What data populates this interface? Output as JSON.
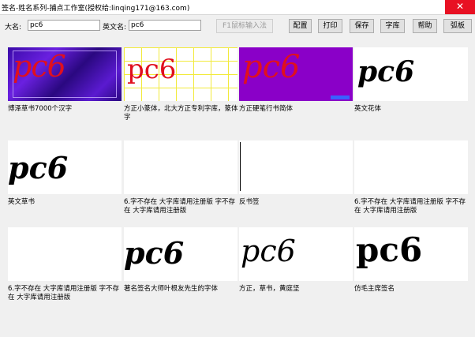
{
  "window": {
    "title": "签名-姓名系列-捕点工作室(授权给:linqing171@163.com)",
    "close_glyph": "✕"
  },
  "toolbar": {
    "chinese_name_label": "大名:",
    "chinese_name_value": "pc6",
    "english_name_label": "英文名:",
    "english_name_value": "pc6",
    "handwrite_input_label": "F1鼠标输入法",
    "config_label": "配置",
    "print_label": "打印",
    "save_label": "保存",
    "font_library_label": "字库",
    "help_label": "帮助",
    "template_label": "弧板"
  },
  "styles": [
    {
      "sample": "pc6",
      "caption": "博泽草书7000个汉字"
    },
    {
      "sample": "pc6",
      "caption": "方正小篆体，北大方正专利字库，篆体字"
    },
    {
      "sample": "pc6",
      "caption": "方正硬笔行书简体"
    },
    {
      "sample": "pc6",
      "caption": "英文花体"
    },
    {
      "sample": "pc6",
      "caption": "英文草书"
    },
    {
      "sample": "",
      "caption": "6.字不存在 大字库请用注册版 字不存在 大字库请用注册版"
    },
    {
      "sample": "",
      "caption": "反书签"
    },
    {
      "sample": "",
      "caption": "6.字不存在 大字库请用注册版 字不存在 大字库请用注册版"
    },
    {
      "sample": "",
      "caption": "6.字不存在 大字库请用注册版 字不存在 大字库请用注册版"
    },
    {
      "sample": "pc6",
      "caption": "著名签名大师叶根友先生的字体"
    },
    {
      "sample": "pc6",
      "caption": "方正，草书，黄庭坚"
    },
    {
      "sample": "pc6",
      "caption": "仿毛主席签名"
    }
  ],
  "colors": {
    "red_ink": "#e0101e",
    "black_ink": "#000000",
    "purple_bg": "#8a00c8",
    "yellow_grid": "#f2ea3a",
    "close_red": "#e81123"
  }
}
